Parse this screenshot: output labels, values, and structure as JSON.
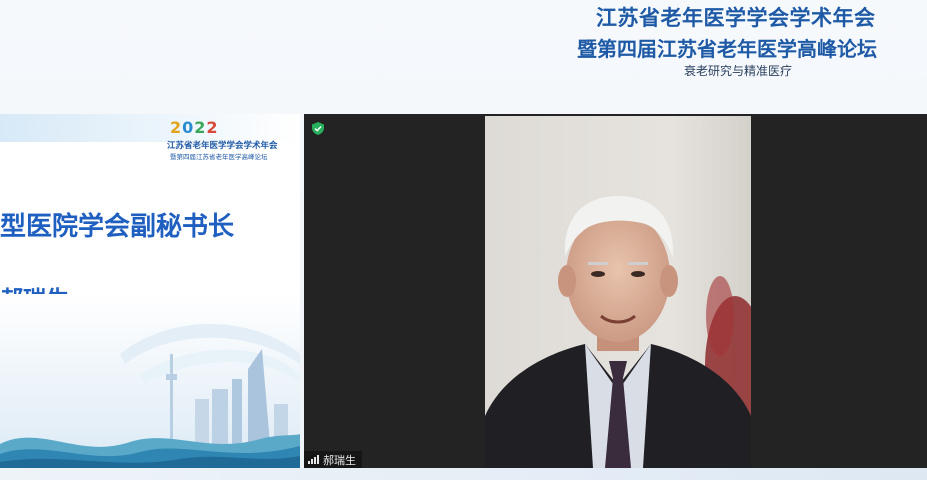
{
  "header": {
    "line1": "江苏省老年医学学会学术年会",
    "line2": "暨第四届江苏省老年医学高峰论坛",
    "subtitle": "衰老研究与精准医疗"
  },
  "slide": {
    "year_digits": [
      "2",
      "0",
      "2",
      "2"
    ],
    "logo_line1": "江苏省老年医学学会学术年会",
    "logo_line2": "暨第四届江苏省老年医学高峰论坛",
    "title": "型医院学会副秘书长",
    "name": "郝瑞生"
  },
  "video": {
    "participant_name": "郝瑞生",
    "shield_icon": "shield-check-icon",
    "signal_icon": "signal-bars-icon"
  },
  "colors": {
    "header_blue": "#1e5aa6",
    "slide_blue": "#1f5fc0",
    "video_bg": "#232323"
  }
}
